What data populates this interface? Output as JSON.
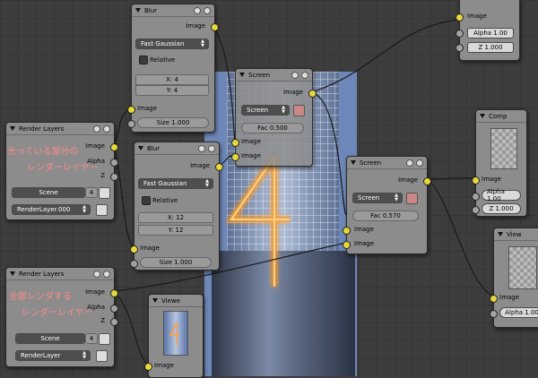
{
  "nodes": {
    "top_right": {
      "image": "Image",
      "alpha": "Alpha 1.00",
      "z": "Z 1.000"
    },
    "blur1": {
      "title": "Blur",
      "image_out": "Image",
      "filter": "Fast Gaussian",
      "relative": "Relative",
      "x": "X: 4",
      "y": "Y: 4",
      "image_in": "Image",
      "size": "Size 1.000"
    },
    "render1": {
      "title": "Render Layers",
      "image": "Image",
      "alpha": "Alpha",
      "z": "Z",
      "scene": "Scene",
      "scene_num": "4",
      "layer": "RenderLayer.000"
    },
    "screen1": {
      "title": "Screen",
      "image_out": "Image",
      "blend": "Screen",
      "fac": "Fac 0.500",
      "image_a": "Image",
      "image_b": "Image"
    },
    "blur2": {
      "title": "Blur",
      "image_out": "Image",
      "filter": "Fast Gaussian",
      "relative": "Relative",
      "x": "X: 12",
      "y": "Y: 12",
      "image_in": "Image",
      "size": "Size 1.000"
    },
    "screen2": {
      "title": "Screen",
      "image_out": "Image",
      "blend": "Screen",
      "fac": "Fac 0.570",
      "image_a": "Image",
      "image_b": "Image"
    },
    "comp": {
      "title": "Comp",
      "image": "Image",
      "alpha": "Alpha 1.00",
      "z": "Z 1.000"
    },
    "render2": {
      "title": "Render Layers",
      "image": "Image",
      "alpha": "Alpha",
      "z": "Z",
      "scene": "Scene",
      "scene_num": "4",
      "layer": "RenderLayer"
    },
    "viewer": {
      "title": "Viewe",
      "image": "Image"
    },
    "view": {
      "title": "View",
      "image": "Image",
      "alpha": "Alpha 1.00"
    }
  },
  "annotations": {
    "glow_line1": "光っている部分の",
    "glow_line2": "レンダーレイヤー",
    "all_line1": "全部レンダする",
    "all_line2": "レンダーレイヤー"
  },
  "backdrop": {
    "digit": "4"
  },
  "colors": {
    "socket_image": "#e6d83a",
    "socket_value": "#a3a3a3",
    "node_bg": "#8c8c8c",
    "annotation": "#ff8a8a",
    "glow": "#ffa020"
  }
}
